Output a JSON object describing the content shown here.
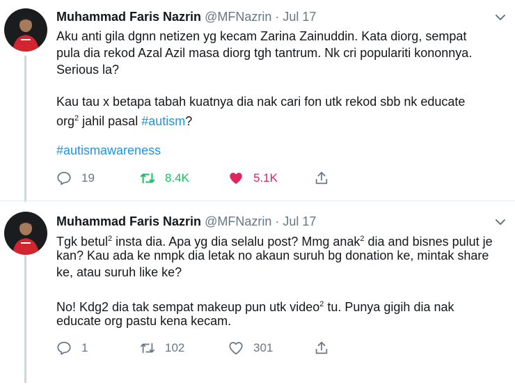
{
  "tweets": [
    {
      "author": {
        "name": "Muhammad Faris Nazrin",
        "handle": "@MFNazrin"
      },
      "separator": "·",
      "date": "Jul 17",
      "lines": [
        "Aku anti gila dgnn netizen yg kecam Zarina Zainuddin. Kata diorg, sempat",
        "pula dia rekod Azal Azil masa diorg tgh tantrum. Nk cri populariti kononnya.",
        "Serious la?"
      ],
      "para2_line1": "Kau tau x betapa tabah kuatnya dia nak cari fon utk rekod sbb nk educate",
      "para2_line2_prefix": "org",
      "para2_line2_sup": "2",
      "para2_line2_text": " jahil pasal ",
      "para2_hashtag": "#autism",
      "para2_line2_suffix": "?",
      "hashtag_line": "#autismawareness",
      "stats": {
        "replies": "19",
        "retweets": "8.4K",
        "likes": "5.1K"
      },
      "retweeted": true,
      "liked": true
    },
    {
      "author": {
        "name": "Muhammad Faris Nazrin",
        "handle": "@MFNazrin"
      },
      "separator": "·",
      "date": "Jul 17",
      "l1a": "Tgk betul",
      "l1sup": "2",
      "l1b": " insta dia. Apa yg dia selalu post? Mmg anak",
      "l1sup2": "2",
      "l1c": " dia and bisnes pulut je",
      "l2": "kan? Kau ada ke nmpk dia letak no akaun suruh bg donation ke, mintak share",
      "l3": "ke, atau suruh like ke?",
      "l4a": "No! Kdg2 dia tak sempat makeup pun utk video",
      "l4sup": "2",
      "l4b": " tu. Punya gigih dia nak",
      "l5": "educate org pastu kena kecam.",
      "stats": {
        "replies": "1",
        "retweets": "102",
        "likes": "301"
      },
      "retweeted": false,
      "liked": false
    }
  ],
  "colors": {
    "text": "#14171a",
    "muted": "#657786",
    "hashtag": "#1b95e0",
    "retweet_active": "#17bf63",
    "like_active": "#e0245e",
    "thread_line": "#ccd6dd"
  },
  "icons": {
    "avatar": "avatar",
    "caret": "chevron-down-icon",
    "reply": "reply-icon",
    "retweet": "retweet-icon",
    "like": "heart-icon",
    "share": "share-icon"
  }
}
